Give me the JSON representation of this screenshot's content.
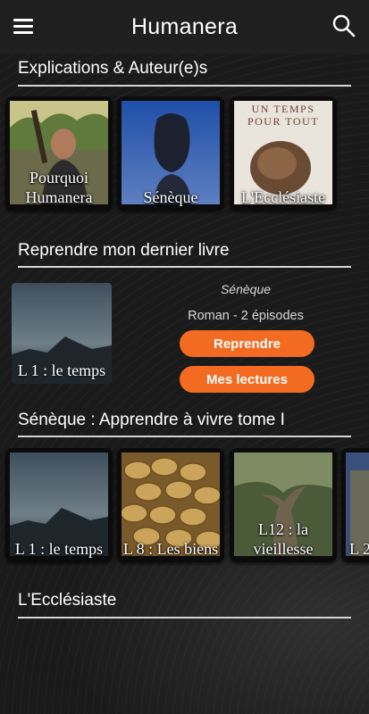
{
  "app": {
    "title": "Humanera"
  },
  "icons": {
    "menu": "menu-icon",
    "search": "search-icon"
  },
  "colors": {
    "accent": "#f26b21",
    "appbar": "#1f1f1f",
    "background": "#1b1b1b"
  },
  "sections": {
    "explications": {
      "title": "Explications & Auteur(e)s",
      "cards": [
        {
          "label": "Pourquoi Humanera"
        },
        {
          "label": "Sénèque"
        },
        {
          "label": "L'Ecclésiaste",
          "cover_title": "UN TEMPS POUR TOUT"
        }
      ]
    },
    "resume": {
      "title": "Reprendre mon dernier livre",
      "thumb_label": "L 1 : le temps",
      "author": "Sénèque",
      "meta": "Roman - 2 épisodes",
      "resume_button": "Reprendre",
      "readings_button": "Mes lectures"
    },
    "seneque": {
      "title": "Sénèque : Apprendre à vivre tome I",
      "cards": [
        {
          "label": "L 1 : le temps"
        },
        {
          "label": "L 8 : Les biens"
        },
        {
          "label": "L12 : la vieillesse"
        },
        {
          "label": "L 2"
        }
      ]
    },
    "ecclesiaste": {
      "title": "L'Ecclésiaste"
    }
  }
}
